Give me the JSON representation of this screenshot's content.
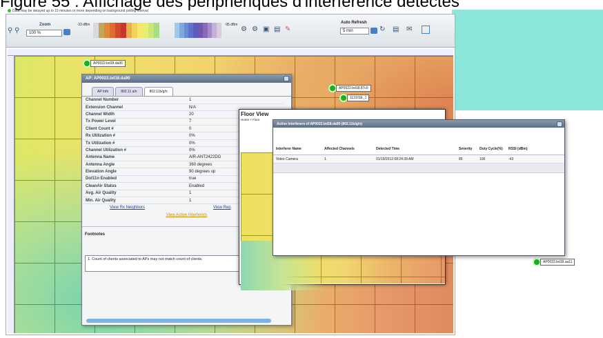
{
  "figure_title": "Figure 55 : Affichage des périphériques d'interférence détectés",
  "notice": "Data may be delayed up to 15 minutes or more depending on background polling interval",
  "toolbar": {
    "zoom_label": "Zoom",
    "zoom_value": "100 %",
    "low_label": "-33 dBm",
    "high_label": "-95 dBm",
    "auto_refresh_label": "Auto Refresh",
    "auto_refresh_value": "5 min"
  },
  "heatmap_colors": [
    "#8bd8b5",
    "#dde868",
    "#f2d36d",
    "#ebb56a",
    "#e08a60"
  ],
  "access_points": [
    {
      "label": "AP0022.bd18.da90"
    },
    {
      "label": "AP0022.bd18.87c0"
    },
    {
      "label": "1131/SE_1"
    },
    {
      "label": "AP0022.bd18.aa11"
    }
  ],
  "ap_popup": {
    "title": "AP: AP0022.bd18.da90",
    "tabs": [
      "AP Info",
      "802.11 a/n",
      "802.11b/g/n"
    ],
    "rows": [
      {
        "k": "Channel Number",
        "v": "1"
      },
      {
        "k": "Extension Channel",
        "v": "N/A"
      },
      {
        "k": "Channel Width",
        "v": "20"
      },
      {
        "k": "Tx Power Level",
        "v": "7"
      },
      {
        "k": "Client Count #",
        "v": "0"
      },
      {
        "k": "Rx Utilization #",
        "v": "0%"
      },
      {
        "k": "Tx Utilization #",
        "v": "0%"
      },
      {
        "k": "Channel Utilization #",
        "v": "0%"
      },
      {
        "k": "Antenna Name",
        "v": "AIR-ANT2422DG"
      },
      {
        "k": "Antenna Angle",
        "v": "360 degrees"
      },
      {
        "k": "Elevation Angle",
        "v": "90 degrees up"
      },
      {
        "k": "Dot11n Enabled",
        "v": "true"
      },
      {
        "k": "CleanAir Status",
        "v": "Enabled"
      },
      {
        "k": "Avg. Air Quality",
        "v": "1"
      },
      {
        "k": "Min. Air Quality",
        "v": "1"
      }
    ],
    "link_neighbors": "View Rx Neighbors",
    "link_rep": "View Rep",
    "link_active": "View Active Interferers",
    "footnotes_heading": "Footnotes",
    "footnote_text": "1. Count of clients associated to APs may not match count of clients."
  },
  "floor_view": {
    "title": "Floor View",
    "crumb": "Home > Floor"
  },
  "active_interferers": {
    "title": "Active Interferers of AP0022.bd18.da90 (802.11b/g/n)",
    "columns": [
      "Interferer Name",
      "Affected Channels",
      "Detected Time",
      "Severity",
      "Duty Cycle(%)",
      "RSSI (dBm)"
    ],
    "rows": [
      [
        "Video Camera",
        "1",
        "01/19/2012 08:24:39 AM",
        "85",
        "100",
        "-43"
      ]
    ]
  }
}
